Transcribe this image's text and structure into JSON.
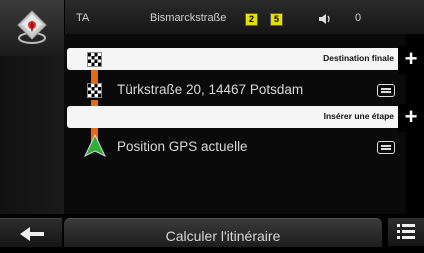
{
  "status": {
    "label_left": "TA",
    "street": "Bismarckstraße",
    "badge_a": "2",
    "badge_b": "5",
    "volume_value": "0"
  },
  "route": {
    "destination_bar_label": "Destination finale",
    "destination_address": "Türkstraße 20, 14467 Potsdam",
    "insert_bar_label": "Insérer une étape",
    "start_label": "Position GPS actuelle",
    "route_color": "#e66a10"
  },
  "bottom": {
    "calculate_label": "Calculer l'itinéraire"
  },
  "icons": {
    "map": "map-compass-icon",
    "back": "back-arrow-icon",
    "list": "list-menu-icon",
    "volume": "speaker-icon",
    "add": "plus-icon",
    "destination": "checkered-flag-icon",
    "start": "green-arrow-icon",
    "row_menu": "row-menu-icon"
  }
}
